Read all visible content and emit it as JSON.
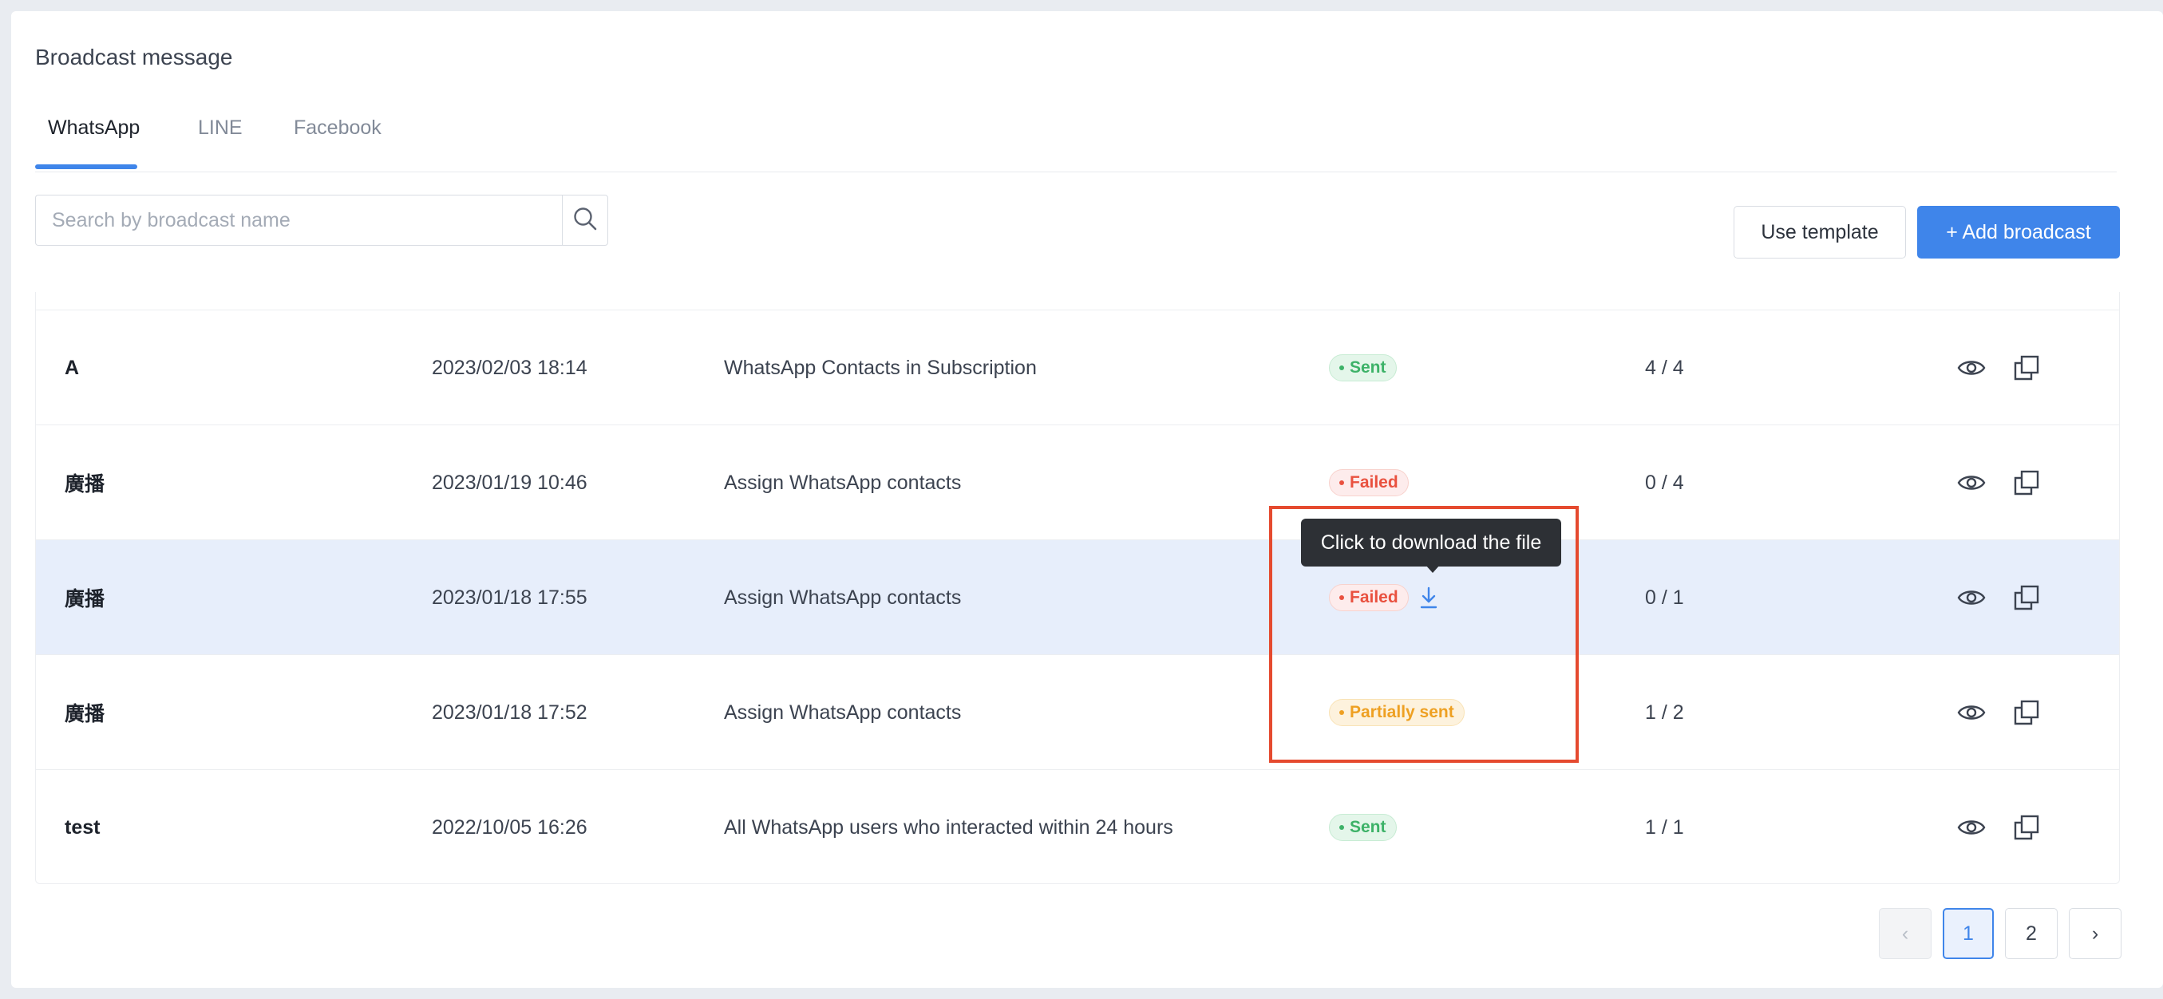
{
  "page": {
    "title": "Broadcast message"
  },
  "tabs": [
    {
      "label": "WhatsApp",
      "active": true
    },
    {
      "label": "LINE",
      "active": false
    },
    {
      "label": "Facebook",
      "active": false
    }
  ],
  "search": {
    "placeholder": "Search by broadcast name",
    "icon": "search-icon"
  },
  "toolbar": {
    "use_template_label": "Use template",
    "add_broadcast_label": "+ Add broadcast"
  },
  "colors": {
    "accent": "#3f85ea",
    "sent": "#3db268",
    "failed": "#e9513f",
    "partial": "#eea022",
    "callout": "#e54a2f"
  },
  "rows": [
    {
      "name": "A",
      "date": "2023/02/03 18:14",
      "audience": "WhatsApp Contacts in Subscription",
      "status": "Sent",
      "count": "4 / 4"
    },
    {
      "name": "廣播",
      "date": "2023/01/19 10:46",
      "audience": "Assign WhatsApp contacts",
      "status": "Failed",
      "count": "0 / 4"
    },
    {
      "name": "廣播",
      "date": "2023/01/18 17:55",
      "audience": "Assign WhatsApp contacts",
      "status": "Failed",
      "count": "0 / 1",
      "highlighted": true,
      "has_download": true
    },
    {
      "name": "廣播",
      "date": "2023/01/18 17:52",
      "audience": "Assign WhatsApp contacts",
      "status": "Partially sent",
      "count": "1 / 2"
    },
    {
      "name": "test",
      "date": "2022/10/05 16:26",
      "audience": "All WhatsApp users who interacted within 24 hours",
      "status": "Sent",
      "count": "1 / 1"
    }
  ],
  "tooltip": {
    "text": "Click to download the file"
  },
  "pagination": {
    "prev": "‹",
    "pages": [
      "1",
      "2"
    ],
    "current": "1",
    "next": "›"
  }
}
